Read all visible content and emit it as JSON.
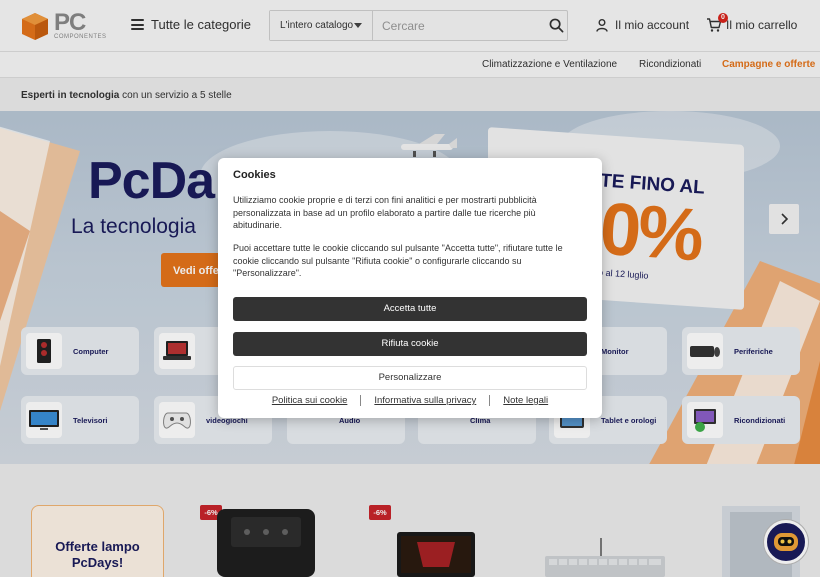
{
  "header": {
    "logo_text": "PC",
    "logo_sub": "COMPONENTES",
    "categories_label": "Tutte le categorie",
    "search_scope": "L'intero catalogo",
    "search_placeholder": "Cercare",
    "account_label": "Il mio account",
    "cart_label": "Il mio carrello",
    "cart_count": "0"
  },
  "subnav": {
    "item1": "Climatizzazione e Ventilazione",
    "item2": "Ricondizionati",
    "item3": "Campagne e offerte"
  },
  "tagline": {
    "bold": "Esperti in tecnologia",
    "rest": " con un servizio a 5 stelle"
  },
  "hero": {
    "title": "PcDa",
    "subtitle": "La tecnologia",
    "cta": "Vedi offe",
    "flag_line1": "TE FINO AL",
    "flag_big": "0%",
    "flag_date": "o al 12 luglio"
  },
  "categories": [
    {
      "label": "Computer"
    },
    {
      "label": ""
    },
    {
      "label": "Monitor"
    },
    {
      "label": "Periferiche"
    },
    {
      "label": "Televisori"
    },
    {
      "label": "videogiochi"
    },
    {
      "label": "Audio"
    },
    {
      "label": "Clima"
    },
    {
      "label": "Tablet e orologi"
    },
    {
      "label": "Ricondizionati"
    }
  ],
  "promo": {
    "line1": "Offerte lampo",
    "line2": "PcDays!",
    "discount1": "-6%",
    "discount2": "-6%"
  },
  "cookie_modal": {
    "title": "Cookies",
    "paragraph1": "Utilizziamo cookie proprie e di terzi con fini analitici e per mostrarti pubblicità personalizzata in base ad un profilo elaborato a partire dalle tue ricerche più abitudinarie.",
    "paragraph2": "Puoi accettare tutte le cookie cliccando sul pulsante \"Accetta tutte\", rifiutare tutte le cookie cliccando sul pulsante \"Rifiuta cookie\" o configurarle cliccando su \"Personalizzare\".",
    "accept_label": "Accetta tutte",
    "reject_label": "Rifiuta cookie",
    "customize_label": "Personalizzare",
    "link_cookie_policy": "Politica sui cookie",
    "link_privacy": "Informativa sulla privacy",
    "link_legal": "Note legali"
  },
  "colors": {
    "brand_orange": "#e5741a",
    "navy": "#1a1b5c",
    "dark_button": "#333333"
  }
}
